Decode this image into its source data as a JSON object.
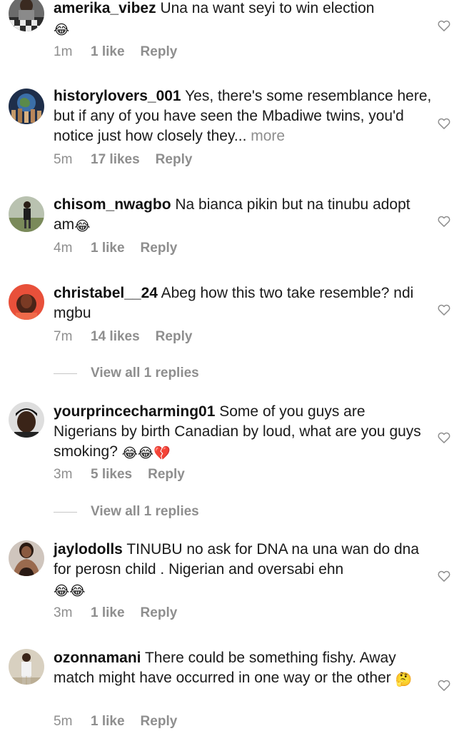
{
  "comments": [
    {
      "username": "amerika_vibez",
      "text": "Una na want seyi to win election",
      "emoji": "😂",
      "time": "1m",
      "likes": "1 like",
      "reply": "Reply"
    },
    {
      "username": "historylovers_001",
      "text": "Yes, there's some resemblance here, but if any of you have seen the Mbadiwe twins, you'd notice just how closely they...",
      "more": "more",
      "time": "5m",
      "likes": "17 likes",
      "reply": "Reply"
    },
    {
      "username": "chisom_nwagbo",
      "text": "Na bianca pikin but na tinubu adopt am",
      "emoji": "😂",
      "time": "4m",
      "likes": "1 like",
      "reply": "Reply"
    },
    {
      "username": "christabel__24",
      "text": "Abeg how this two take resemble? ndi mgbu",
      "time": "7m",
      "likes": "14 likes",
      "reply": "Reply",
      "view_replies": "View all 1 replies"
    },
    {
      "username": "yourprincecharming01",
      "text": "Some of you guys are Nigerians by birth Canadian by loud, what are you guys smoking?",
      "emoji": "😂😂💔",
      "time": "3m",
      "likes": "5 likes",
      "reply": "Reply",
      "view_replies": "View all 1 replies"
    },
    {
      "username": "jaylodolls",
      "text": "TINUBU no ask for DNA na una wan do dna for perosn child . Nigerian and oversabi ehn",
      "emoji": "😂😂",
      "time": "3m",
      "likes": "1 like",
      "reply": "Reply"
    },
    {
      "username": "ozonnamani",
      "text": "There could be something fishy. Away match might have occurred in one way or the other",
      "emoji": "🤔",
      "time": "5m",
      "likes": "1 like",
      "reply": "Reply"
    }
  ],
  "icons": {
    "like": "heart-outline-icon",
    "avatar": "profile-photo"
  },
  "colors": {
    "username": "#111111",
    "body_text": "#1a1a1a",
    "meta_text": "#8e8e8e",
    "divider": "#c7c7c7",
    "background": "#ffffff"
  }
}
